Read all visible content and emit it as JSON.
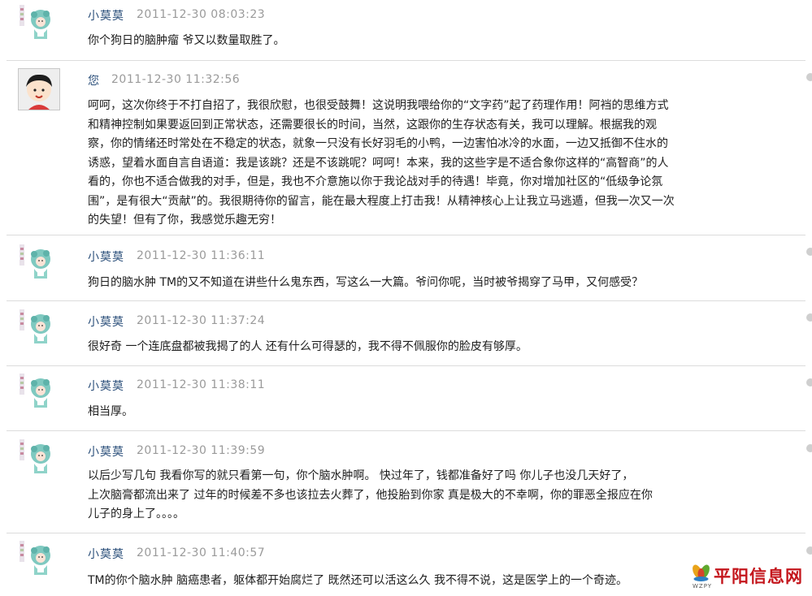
{
  "comments": [
    {
      "author": "小莫莫",
      "time": "2011-12-30 08:03:23",
      "avatar": "doll-avatar",
      "lines": [
        "你个狗日的脑肿瘤  爷又以数量取胜了。"
      ]
    },
    {
      "author": "您",
      "time": "2011-12-30 11:32:56",
      "avatar": "boy-avatar",
      "lines": [
        "呵呵，这次你终于不打自招了，我很欣慰，也很受鼓舞！这说明我喂给你的“文字药”起了药理作用！阿裆的思维方式",
        "和精神控制如果要返回到正常状态，还需要很长的时间，当然，这跟你的生存状态有关，我可以理解。根据我的观",
        "察，你的情绪还时常处在不稳定的状态，就象一只没有长好羽毛的小鸭，一边害怕冰冷的水面，一边又抵御不住水的",
        "诱惑，望着水面自言自语道：我是该跳？还是不该跳呢？呵呵！本来，我的这些字是不适合象你这样的“高智商”的人",
        "看的，你也不适合做我的对手，但是，我也不介意施以你于我论战对手的待遇！毕竟，你对增加社区的“低级争论氛",
        "围”，是有很大“贡献”的。我很期待你的留言，能在最大程度上打击我！从精神核心上让我立马逃遁，但我一次又一次",
        "的失望！但有了你，我感觉乐趣无穷！"
      ]
    },
    {
      "author": "小莫莫",
      "time": "2011-12-30 11:36:11",
      "avatar": "doll-avatar",
      "lines": [
        "狗日的脑水肿  TM的又不知道在讲些什么鬼东西，写这么一大篇。爷问你呢，当时被爷揭穿了马甲，又何感受？"
      ]
    },
    {
      "author": "小莫莫",
      "time": "2011-12-30 11:37:24",
      "avatar": "doll-avatar",
      "lines": [
        "很好奇  一个连底盘都被我揭了的人  还有什么可得瑟的，我不得不佩服你的脸皮有够厚。"
      ]
    },
    {
      "author": "小莫莫",
      "time": "2011-12-30 11:38:11",
      "avatar": "doll-avatar",
      "lines": [
        "相当厚。"
      ]
    },
    {
      "author": "小莫莫",
      "time": "2011-12-30 11:39:59",
      "avatar": "doll-avatar",
      "lines": [
        "以后少写几句  我看你写的就只看第一句，你个脑水肿啊。        快过年了，钱都准备好了吗  你儿子也没几天好了，",
        "上次脑膏都流出来了  过年的时候差不多也该拉去火葬了，他投胎到你家  真是极大的不幸啊，你的罪恶全报应在你",
        "儿子的身上了。。。。"
      ]
    },
    {
      "author": "小莫莫",
      "time": "2011-12-30 11:40:57",
      "avatar": "doll-avatar",
      "lines": [
        "TM的你个脑水肿  脑癌患者，躯体都开始腐烂了 既然还可以活这么久  我不得不说，这是医学上的一个奇迹。"
      ]
    }
  ],
  "watermark": {
    "name": "平阳信息网",
    "sub": "WZPY"
  },
  "colors": {
    "author": "#2b4f7a",
    "time": "#9a9a9a",
    "watermark": "#c4161c"
  }
}
